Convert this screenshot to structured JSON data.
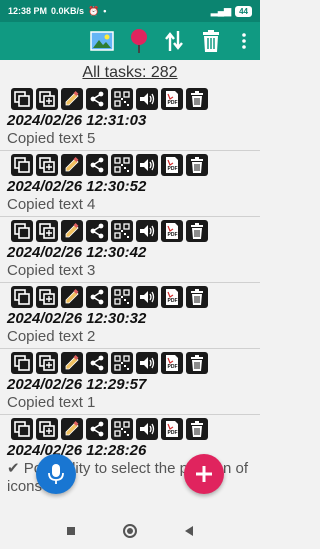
{
  "status_bar": {
    "time": "12:38 PM",
    "speed": "0.0KB/s",
    "battery": "44"
  },
  "toolbar": {
    "icons": [
      "image-icon",
      "pin-icon",
      "sort-icon",
      "trash-icon",
      "more-icon"
    ]
  },
  "list": {
    "header": "All tasks: 282",
    "entries": [
      {
        "date": "2024/02/26 12:31:03",
        "text": "Copied text 5"
      },
      {
        "date": "2024/02/26 12:30:52",
        "text": "Copied text 4"
      },
      {
        "date": "2024/02/26 12:30:42",
        "text": "Copied text 3"
      },
      {
        "date": "2024/02/26 12:30:32",
        "text": "Copied text 2"
      },
      {
        "date": "2024/02/26 12:29:57",
        "text": "Copied text 1"
      },
      {
        "date": "2024/02/26 12:28:26",
        "text": "✔ Possibility to select the position of icons"
      }
    ],
    "action_icons": [
      "copy-icon",
      "copy-add-icon",
      "edit-icon",
      "share-icon",
      "qr-icon",
      "speaker-icon",
      "pdf-icon",
      "delete-icon"
    ]
  },
  "colors": {
    "status_bar": "#0b8470",
    "toolbar": "#109a82",
    "fab_mic": "#1976d2",
    "fab_add": "#e0245e"
  }
}
